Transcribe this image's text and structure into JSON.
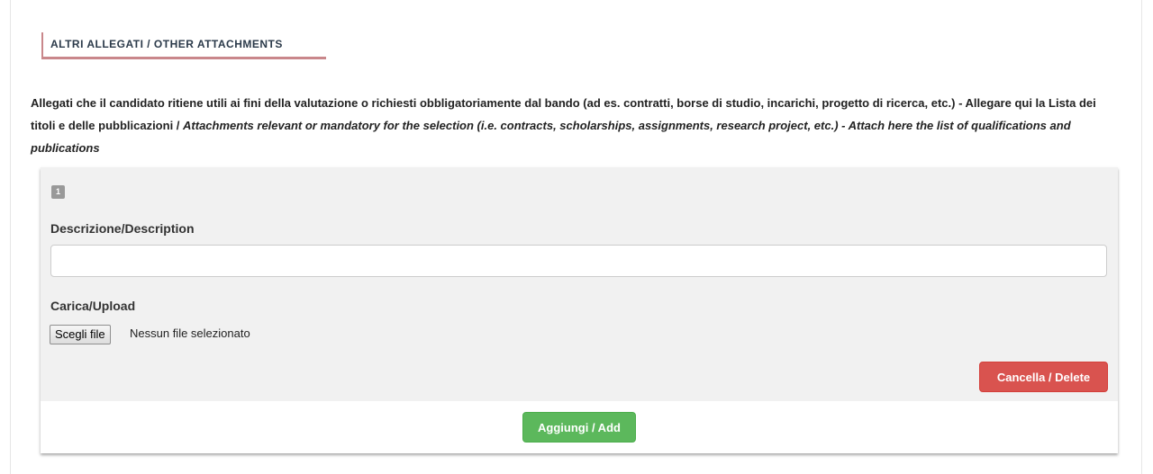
{
  "section": {
    "title": "ALTRI ALLEGATI / OTHER ATTACHMENTS"
  },
  "instructions": {
    "italian": "Allegati che il candidato ritiene utili ai fini della valutazione o richiesti obbligatoriamente dal bando (ad es. contratti, borse di studio, incarichi, progetto di ricerca, etc.) - Allegare qui la Lista dei titoli e delle pubblicazioni /",
    "english": "Attachments relevant or mandatory for the selection (i.e. contracts, scholarships, assignments, research project, etc.) - Attach here the list of qualifications and publications"
  },
  "attachment": {
    "index": "1",
    "description_label": "Descrizione/Description",
    "description_value": "",
    "upload_label": "Carica/Upload",
    "choose_file_label": "Scegli file",
    "file_status": "Nessun file selezionato",
    "delete_label": "Cancella / Delete"
  },
  "actions": {
    "add_label": "Aggiungi / Add"
  },
  "colors": {
    "title_accent": "#c9878b",
    "delete_button": "#d9534f",
    "add_button": "#5cb85c",
    "panel_background": "#f1f1f1"
  }
}
